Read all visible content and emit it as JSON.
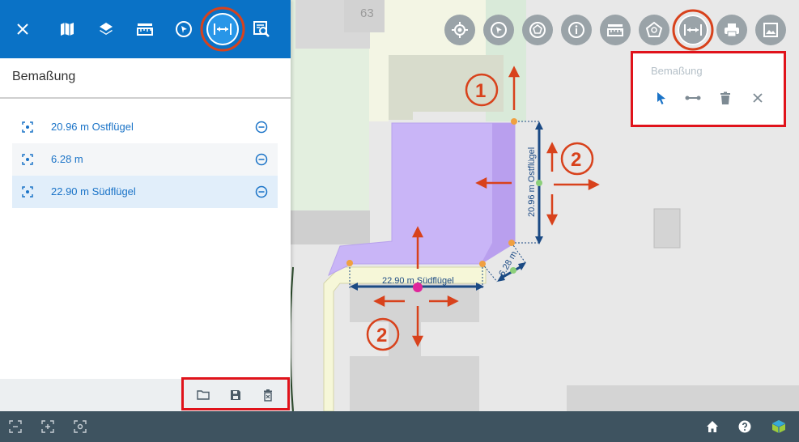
{
  "panel": {
    "title": "Bemaßung",
    "toolbar": [
      {
        "icon": "close-icon"
      },
      {
        "icon": "map-icon"
      },
      {
        "icon": "layers-icon"
      },
      {
        "icon": "ruler-icon"
      },
      {
        "icon": "select-icon"
      },
      {
        "icon": "dimension-icon",
        "active": true
      },
      {
        "icon": "search-map-icon"
      }
    ],
    "measurements": [
      {
        "label": "20.96 m Ostflügel",
        "selected": false
      },
      {
        "label": "6.28 m",
        "selected": false
      },
      {
        "label": "22.90 m Südflügel",
        "selected": true
      }
    ],
    "footer": [
      {
        "icon": "folder-open-icon"
      },
      {
        "icon": "save-icon"
      },
      {
        "icon": "delete-icon"
      }
    ]
  },
  "map": {
    "house_number": "63",
    "dimension_labels": {
      "east": "20.96 m Ostflügel",
      "short": "6.28 m",
      "south": "22.90 m Südflügel"
    },
    "annotations": [
      "1",
      "2",
      "2"
    ],
    "colors": {
      "building_highlight": "#c9b5f7",
      "dimension_line": "#1b4a84",
      "annotation": "#d8421c",
      "frame": "#e0131b"
    }
  },
  "map_tools": [
    {
      "icon": "locate-icon"
    },
    {
      "icon": "select-icon"
    },
    {
      "icon": "polygon-select-icon"
    },
    {
      "icon": "info-icon"
    },
    {
      "icon": "ruler-icon"
    },
    {
      "icon": "polygon-search-icon"
    },
    {
      "icon": "dimension-icon",
      "active": true
    },
    {
      "icon": "print-icon"
    },
    {
      "icon": "image-icon"
    }
  ],
  "popup": {
    "title": "Bemaßung",
    "buttons": [
      {
        "icon": "pointer-icon"
      },
      {
        "icon": "line-icon"
      },
      {
        "icon": "trash-icon"
      },
      {
        "icon": "close-icon"
      }
    ]
  },
  "statusbar": {
    "left": [
      {
        "icon": "zoom-out-icon"
      },
      {
        "icon": "zoom-in-icon"
      },
      {
        "icon": "center-icon"
      }
    ],
    "right": [
      {
        "icon": "home-icon"
      },
      {
        "icon": "help-icon"
      },
      {
        "icon": "logo-icon"
      }
    ]
  }
}
